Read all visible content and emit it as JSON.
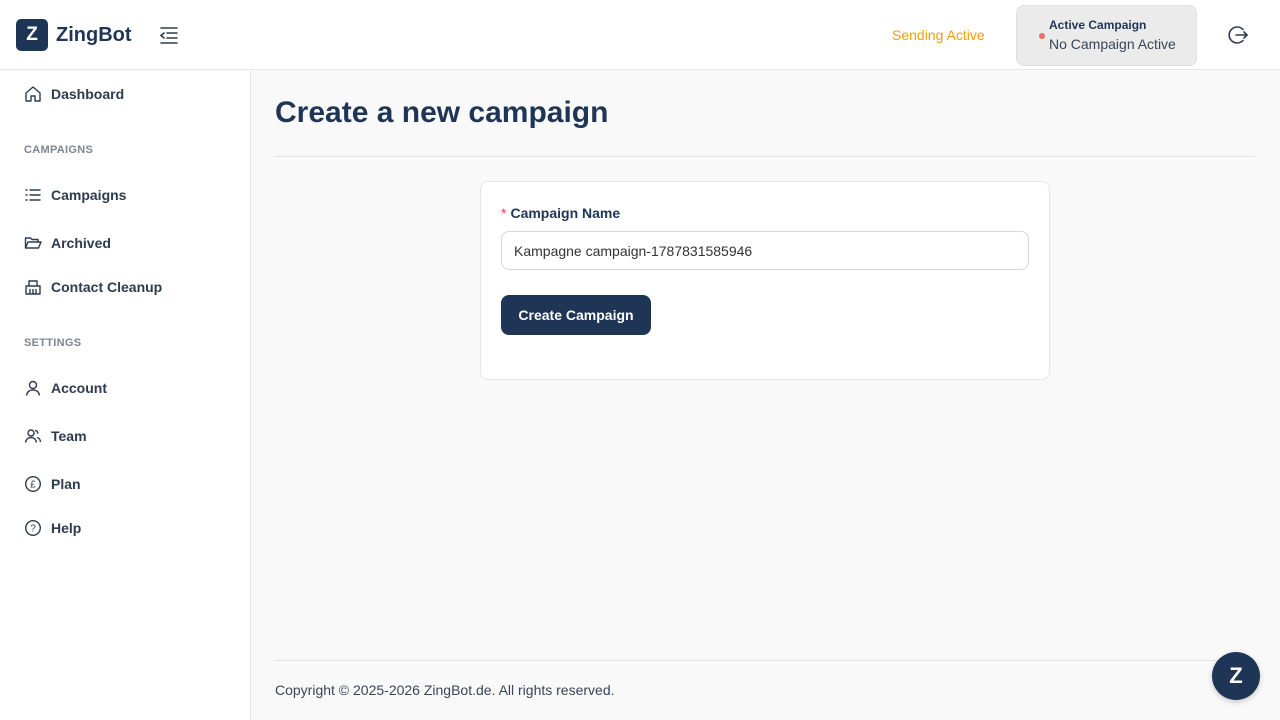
{
  "header": {
    "logo_mark": "Z",
    "logo_text": "ZingBot",
    "sending_status": "Sending Active",
    "active_campaign_title": "Active Campaign",
    "active_campaign_value": "No Campaign Active"
  },
  "sidebar": {
    "dashboard": "Dashboard",
    "campaigns_section": "CAMPAIGNS",
    "campaigns": "Campaigns",
    "archived": "Archived",
    "contact_cleanup": "Contact Cleanup",
    "settings_section": "SETTINGS",
    "account": "Account",
    "team": "Team",
    "plan": "Plan",
    "help": "Help"
  },
  "main": {
    "title": "Create a new campaign",
    "form": {
      "required_mark": "*",
      "field_label": "Campaign Name",
      "field_value": "Kampagne campaign-1787831585946",
      "submit_label": "Create Campaign"
    },
    "footer": "Copyright © 2025-2026 ZingBot.de. All rights reserved."
  },
  "chat": {
    "label": "Z"
  },
  "colors": {
    "brand": "#1f3556",
    "sending_status": "#f2a100",
    "inactive_dot": "#f26b6b",
    "required": "#e5484d"
  }
}
